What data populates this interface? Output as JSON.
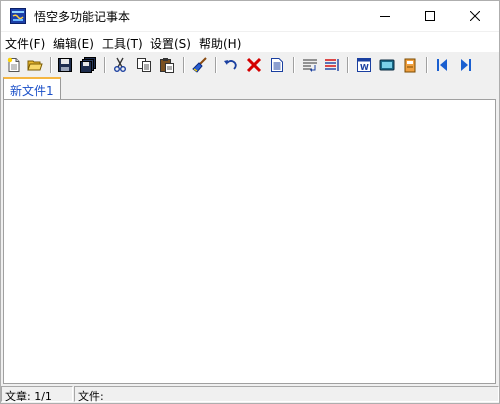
{
  "window": {
    "title": "悟空多功能记事本",
    "controls": [
      "minimize-icon",
      "maximize-icon",
      "close-icon"
    ]
  },
  "menu": {
    "items": [
      {
        "label": "文件(F)"
      },
      {
        "label": "编辑(E)"
      },
      {
        "label": "工具(T)"
      },
      {
        "label": "设置(S)"
      },
      {
        "label": "帮助(H)"
      }
    ]
  },
  "toolbar": {
    "icons": [
      "new-file-icon",
      "open-folder-icon",
      "save-icon",
      "save-all-icon",
      "cut-icon",
      "copy-icon",
      "paste-icon",
      "clear-icon",
      "undo-icon",
      "delete-icon",
      "document-icon",
      "word-wrap-icon",
      "line-numbers-icon",
      "word-icon",
      "screen-icon",
      "note-icon",
      "previous-icon",
      "next-icon"
    ],
    "colors": {
      "accent_blue": "#1a5fd0",
      "delete_red": "#d40000"
    }
  },
  "tabs": [
    {
      "label": "新文件1",
      "active": true
    }
  ],
  "editor": {
    "content": ""
  },
  "status": {
    "chapter": "文章: 1/1",
    "file": "文件:"
  }
}
